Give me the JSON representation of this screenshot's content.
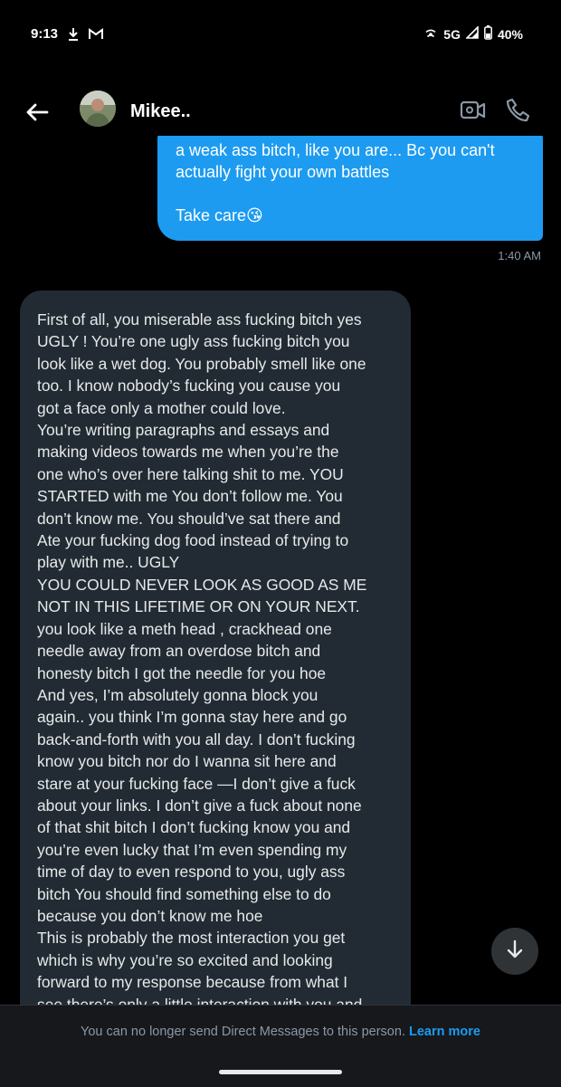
{
  "status_bar": {
    "time": "9:13",
    "network": "5G",
    "battery": "40%",
    "icons": [
      "download-icon",
      "gmail-icon",
      "hotspot-icon",
      "signal-icon",
      "battery-icon"
    ]
  },
  "header": {
    "contact_name": "Mikee..",
    "icons": [
      "back-arrow-icon",
      "video-call-icon",
      "phone-icon"
    ]
  },
  "messages": {
    "sent": {
      "text": "a weak ass bitch, like you are... Bc you can't\nactually fight your own battles\n\nTake care😘",
      "timestamp": "1:40 AM"
    },
    "received": {
      "text": "First of all, you miserable ass fucking bitch yes\nUGLY ! You’re one ugly ass fucking bitch you\nlook like a wet dog. You probably smell like one\ntoo. I know nobody’s fucking you cause you\ngot a face only a mother could love.\nYou’re writing paragraphs and essays and\nmaking videos towards me when you’re the\none who’s over here talking shit to me. YOU\nSTARTED with me You don’t follow me. You\ndon’t know me. You should’ve sat there and\nAte your fucking dog food instead of trying to\nplay with me.. UGLY\nYOU COULD NEVER LOOK AS GOOD AS ME\nNOT IN THIS LIFETIME OR ON YOUR NEXT.\nyou look like a meth head , crackhead one\nneedle away from an overdose bitch and\nhonesty bitch I got the needle for you hoe\nAnd yes, I’m absolutely gonna block you\nagain.. you think I’m gonna stay here and go\nback-and-forth with you all day. I don’t fucking\nknow you bitch nor do I wanna sit here and\nstare at your fucking face —I don’t give a fuck\nabout your links. I don’t give a fuck about none\nof that shit bitch I don’t fucking know you and\nyou’re even lucky that I’m even spending my\ntime of day to even respond to you, ugly ass\nbitch You should find something else to do\nbecause you don’t know me hoe\nThis is probably the most interaction you get\nwhich is why you’re so excited and looking\nforward to my response because from what I\nsee there’s only a little interaction with you and"
    }
  },
  "footer": {
    "notice": "You can no longer send Direct Messages to this person.",
    "link": "Learn more"
  },
  "colors": {
    "background": "#000000",
    "sent_bubble": "#1d9bf0",
    "received_bubble": "#222b33",
    "link": "#1d9bf0",
    "muted_text": "#8b98a5"
  }
}
